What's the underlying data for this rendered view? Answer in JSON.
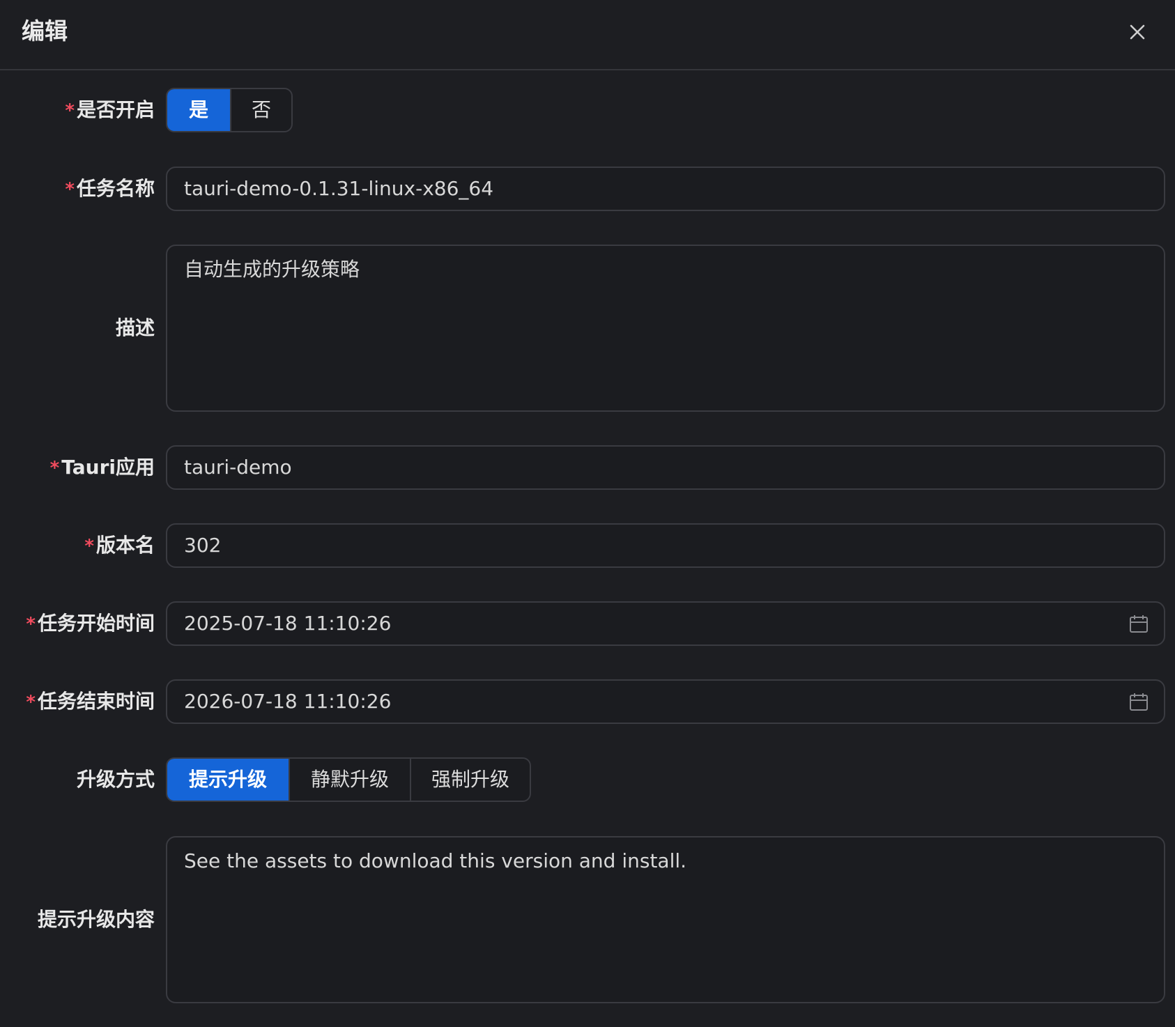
{
  "dialog": {
    "title": "编辑"
  },
  "form": {
    "enabled": {
      "label": "是否开启",
      "required_mark": "*",
      "options": [
        "是",
        "否"
      ],
      "selected": "是"
    },
    "task_name": {
      "label": "任务名称",
      "required_mark": "*",
      "value": "tauri-demo-0.1.31-linux-x86_64"
    },
    "description": {
      "label": "描述",
      "value": "自动生成的升级策略"
    },
    "tauri_app": {
      "label": "Tauri应用",
      "required_mark": "*",
      "value": "tauri-demo"
    },
    "version_name": {
      "label": "版本名",
      "required_mark": "*",
      "value": "302"
    },
    "start_time": {
      "label": "任务开始时间",
      "required_mark": "*",
      "value": "2025-07-18 11:10:26",
      "icon": "calendar-icon"
    },
    "end_time": {
      "label": "任务结束时间",
      "required_mark": "*",
      "value": "2026-07-18 11:10:26",
      "icon": "calendar-icon"
    },
    "upgrade_mode": {
      "label": "升级方式",
      "options": [
        "提示升级",
        "静默升级",
        "强制升级"
      ],
      "selected": "提示升级"
    },
    "upgrade_prompt": {
      "label": "提示升级内容",
      "value": "See the assets to download this version and install."
    }
  },
  "colors": {
    "background": "#1d1e22",
    "accent": "#1565d8",
    "required": "#f14c5e",
    "border": "#3a3b41"
  }
}
